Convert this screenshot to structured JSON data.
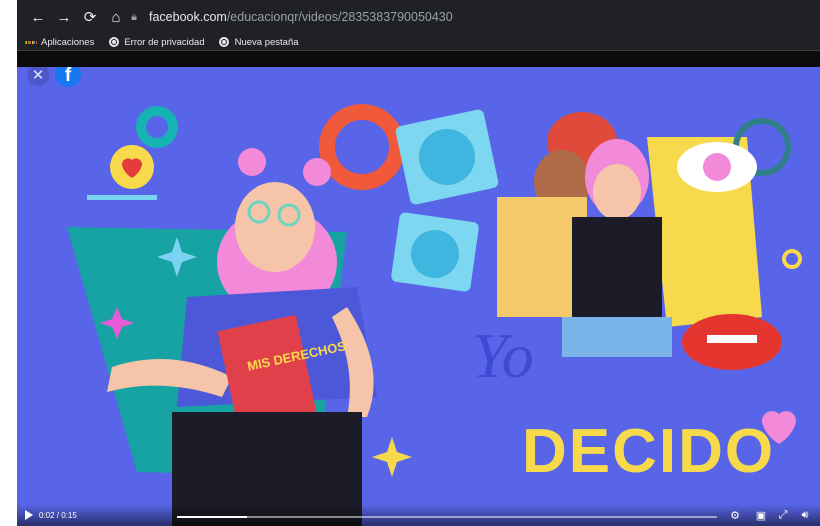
{
  "browser": {
    "url_host": "facebook.com",
    "url_path": "/educacionqr/videos/2835383790050430",
    "bookmarks": [
      {
        "label": "Aplicaciones",
        "icon": "apps-grid-icon"
      },
      {
        "label": "Error de privacidad",
        "icon": "globe-icon"
      },
      {
        "label": "Nueva pestaña",
        "icon": "globe-icon"
      }
    ]
  },
  "overlay": {
    "close_icon": "close-icon",
    "logo": "facebook-logo"
  },
  "video": {
    "artwork_text_top": "MIS DERECHOS",
    "artwork_text_bottom_1": "Yo",
    "artwork_text_bottom_2": "DECIDO",
    "time": "0:02 / 0:15",
    "progress_fraction": 0.13
  },
  "colors": {
    "video_bg": "#5865e8",
    "teal": "#17a3a3",
    "pink": "#f28ad9",
    "orange": "#f05a3a",
    "yellow": "#f7d94c"
  }
}
